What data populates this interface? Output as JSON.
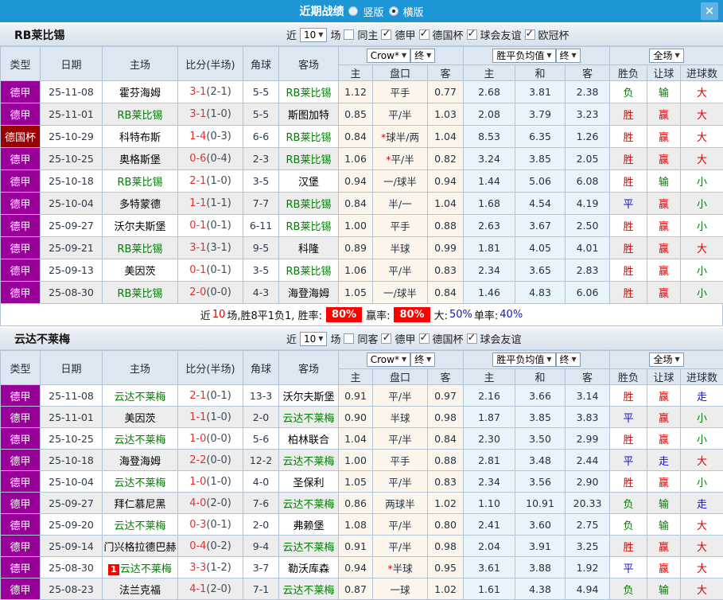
{
  "titlebar": {
    "title": "近期战绩",
    "layout_options": [
      {
        "label": "竖版",
        "selected": false
      },
      {
        "label": "横版",
        "selected": true
      }
    ],
    "close_icon": "✕"
  },
  "table_header": {
    "base_cols": [
      "类型",
      "日期",
      "主场",
      "比分(半场)",
      "角球",
      "客场"
    ],
    "groups": [
      {
        "selects": [
          "Crow*",
          "终"
        ],
        "sub": [
          "主",
          "盘口",
          "客"
        ]
      },
      {
        "selects": [
          "胜平负均值",
          "终"
        ],
        "sub": [
          "主",
          "和",
          "客"
        ]
      },
      {
        "selects": [
          "全场"
        ],
        "sub": [
          "胜负",
          "让球",
          "进球数"
        ]
      }
    ]
  },
  "colors": {
    "topbar_blue": "#1e96d5",
    "league": {
      "德甲": "#99009a",
      "德国杯": "#990000"
    },
    "outcome": {
      "胜": "#dd0000",
      "平": "#1414cc",
      "负": "#008000",
      "赢": "#dd0000",
      "输": "#008000",
      "走": "#1414cc",
      "大": "#dd0000",
      "小": "#008000"
    },
    "score_red": "#e13232",
    "highlight_green": "#008000"
  },
  "sections": [
    {
      "team": "RB莱比锡",
      "filter": {
        "near": "近",
        "count": "10",
        "unit": "场",
        "same_label": "同主",
        "same_checked": false,
        "leagues": [
          "德甲",
          "德国杯",
          "球会友谊",
          "欧冠杯"
        ]
      },
      "rows": [
        {
          "league": "德甲",
          "date": "25-11-08",
          "home": "霍芬海姆",
          "home_hl": false,
          "home_badge": "",
          "score": "3-1",
          "half": "(2-1)",
          "corners": "5-5",
          "away": "RB莱比锡",
          "away_hl": true,
          "odds": [
            "1.12",
            "平手",
            "0.77"
          ],
          "star": false,
          "avg": [
            "2.68",
            "3.81",
            "2.38"
          ],
          "results": [
            "负",
            "输",
            "大"
          ]
        },
        {
          "league": "德甲",
          "date": "25-11-01",
          "home": "RB莱比锡",
          "home_hl": true,
          "home_badge": "",
          "score": "3-1",
          "half": "(1-0)",
          "corners": "5-5",
          "away": "斯图加特",
          "away_hl": false,
          "odds": [
            "0.85",
            "平/半",
            "1.03"
          ],
          "star": false,
          "avg": [
            "2.08",
            "3.79",
            "3.23"
          ],
          "results": [
            "胜",
            "赢",
            "大"
          ]
        },
        {
          "league": "德国杯",
          "date": "25-10-29",
          "home": "科特布斯",
          "home_hl": false,
          "home_badge": "",
          "score": "1-4",
          "half": "(0-3)",
          "corners": "6-6",
          "away": "RB莱比锡",
          "away_hl": true,
          "odds": [
            "0.84",
            "球半/两",
            "1.04"
          ],
          "star": true,
          "avg": [
            "8.53",
            "6.35",
            "1.26"
          ],
          "results": [
            "胜",
            "赢",
            "大"
          ]
        },
        {
          "league": "德甲",
          "date": "25-10-25",
          "home": "奥格斯堡",
          "home_hl": false,
          "home_badge": "",
          "score": "0-6",
          "half": "(0-4)",
          "corners": "2-3",
          "away": "RB莱比锡",
          "away_hl": true,
          "odds": [
            "1.06",
            "平/半",
            "0.82"
          ],
          "star": true,
          "avg": [
            "3.24",
            "3.85",
            "2.05"
          ],
          "results": [
            "胜",
            "赢",
            "大"
          ]
        },
        {
          "league": "德甲",
          "date": "25-10-18",
          "home": "RB莱比锡",
          "home_hl": true,
          "home_badge": "",
          "score": "2-1",
          "half": "(1-0)",
          "corners": "3-5",
          "away": "汉堡",
          "away_hl": false,
          "odds": [
            "0.94",
            "一/球半",
            "0.94"
          ],
          "star": false,
          "avg": [
            "1.44",
            "5.06",
            "6.08"
          ],
          "results": [
            "胜",
            "输",
            "小"
          ]
        },
        {
          "league": "德甲",
          "date": "25-10-04",
          "home": "多特蒙德",
          "home_hl": false,
          "home_badge": "",
          "score": "1-1",
          "half": "(1-1)",
          "corners": "7-7",
          "away": "RB莱比锡",
          "away_hl": true,
          "odds": [
            "0.84",
            "半/一",
            "1.04"
          ],
          "star": false,
          "avg": [
            "1.68",
            "4.54",
            "4.19"
          ],
          "results": [
            "平",
            "赢",
            "小"
          ]
        },
        {
          "league": "德甲",
          "date": "25-09-27",
          "home": "沃尔夫斯堡",
          "home_hl": false,
          "home_badge": "",
          "score": "0-1",
          "half": "(0-1)",
          "corners": "6-11",
          "away": "RB莱比锡",
          "away_hl": true,
          "odds": [
            "1.00",
            "平手",
            "0.88"
          ],
          "star": false,
          "avg": [
            "2.63",
            "3.67",
            "2.50"
          ],
          "results": [
            "胜",
            "赢",
            "小"
          ]
        },
        {
          "league": "德甲",
          "date": "25-09-21",
          "home": "RB莱比锡",
          "home_hl": true,
          "home_badge": "",
          "score": "3-1",
          "half": "(3-1)",
          "corners": "9-5",
          "away": "科隆",
          "away_hl": false,
          "odds": [
            "0.89",
            "半球",
            "0.99"
          ],
          "star": false,
          "avg": [
            "1.81",
            "4.05",
            "4.01"
          ],
          "results": [
            "胜",
            "赢",
            "大"
          ]
        },
        {
          "league": "德甲",
          "date": "25-09-13",
          "home": "美因茨",
          "home_hl": false,
          "home_badge": "",
          "score": "0-1",
          "half": "(0-1)",
          "corners": "3-5",
          "away": "RB莱比锡",
          "away_hl": true,
          "odds": [
            "1.06",
            "平/半",
            "0.83"
          ],
          "star": false,
          "avg": [
            "2.34",
            "3.65",
            "2.83"
          ],
          "results": [
            "胜",
            "赢",
            "小"
          ]
        },
        {
          "league": "德甲",
          "date": "25-08-30",
          "home": "RB莱比锡",
          "home_hl": true,
          "home_badge": "",
          "score": "2-0",
          "half": "(0-0)",
          "corners": "4-3",
          "away": "海登海姆",
          "away_hl": false,
          "odds": [
            "1.05",
            "一/球半",
            "0.84"
          ],
          "star": false,
          "avg": [
            "1.46",
            "4.83",
            "6.06"
          ],
          "results": [
            "胜",
            "赢",
            "小"
          ]
        }
      ],
      "summary": [
        {
          "text": "近"
        },
        {
          "text": "10",
          "style": "red"
        },
        {
          "text": "场,胜8平1负1, 胜率:"
        },
        {
          "text": "80%",
          "style": "badge"
        },
        {
          "text": "赢率:"
        },
        {
          "text": "80%",
          "style": "badge"
        },
        {
          "text": "大:"
        },
        {
          "text": "50%",
          "style": "blue"
        },
        {
          "text": " 单率:"
        },
        {
          "text": "40%",
          "style": "blue"
        }
      ]
    },
    {
      "team": "云达不莱梅",
      "filter": {
        "near": "近",
        "count": "10",
        "unit": "场",
        "same_label": "同客",
        "same_checked": false,
        "leagues": [
          "德甲",
          "德国杯",
          "球会友谊"
        ]
      },
      "rows": [
        {
          "league": "德甲",
          "date": "25-11-08",
          "home": "云达不莱梅",
          "home_hl": true,
          "home_badge": "",
          "score": "2-1",
          "half": "(0-1)",
          "corners": "13-3",
          "away": "沃尔夫斯堡",
          "away_hl": false,
          "odds": [
            "0.91",
            "平/半",
            "0.97"
          ],
          "star": false,
          "avg": [
            "2.16",
            "3.66",
            "3.14"
          ],
          "results": [
            "胜",
            "赢",
            "走"
          ]
        },
        {
          "league": "德甲",
          "date": "25-11-01",
          "home": "美因茨",
          "home_hl": false,
          "home_badge": "",
          "score": "1-1",
          "half": "(1-0)",
          "corners": "2-0",
          "away": "云达不莱梅",
          "away_hl": true,
          "odds": [
            "0.90",
            "半球",
            "0.98"
          ],
          "star": false,
          "avg": [
            "1.87",
            "3.85",
            "3.83"
          ],
          "results": [
            "平",
            "赢",
            "小"
          ]
        },
        {
          "league": "德甲",
          "date": "25-10-25",
          "home": "云达不莱梅",
          "home_hl": true,
          "home_badge": "",
          "score": "1-0",
          "half": "(0-0)",
          "corners": "5-6",
          "away": "柏林联合",
          "away_hl": false,
          "odds": [
            "1.04",
            "平/半",
            "0.84"
          ],
          "star": false,
          "avg": [
            "2.30",
            "3.50",
            "2.99"
          ],
          "results": [
            "胜",
            "赢",
            "小"
          ]
        },
        {
          "league": "德甲",
          "date": "25-10-18",
          "home": "海登海姆",
          "home_hl": false,
          "home_badge": "",
          "score": "2-2",
          "half": "(0-0)",
          "corners": "12-2",
          "away": "云达不莱梅",
          "away_hl": true,
          "odds": [
            "1.00",
            "平手",
            "0.88"
          ],
          "star": false,
          "avg": [
            "2.81",
            "3.48",
            "2.44"
          ],
          "results": [
            "平",
            "走",
            "大"
          ]
        },
        {
          "league": "德甲",
          "date": "25-10-04",
          "home": "云达不莱梅",
          "home_hl": true,
          "home_badge": "",
          "score": "1-0",
          "half": "(1-0)",
          "corners": "4-0",
          "away": "圣保利",
          "away_hl": false,
          "odds": [
            "1.05",
            "平/半",
            "0.83"
          ],
          "star": false,
          "avg": [
            "2.34",
            "3.56",
            "2.90"
          ],
          "results": [
            "胜",
            "赢",
            "小"
          ]
        },
        {
          "league": "德甲",
          "date": "25-09-27",
          "home": "拜仁慕尼黑",
          "home_hl": false,
          "home_badge": "",
          "score": "4-0",
          "half": "(2-0)",
          "corners": "7-6",
          "away": "云达不莱梅",
          "away_hl": true,
          "odds": [
            "0.86",
            "两球半",
            "1.02"
          ],
          "star": false,
          "avg": [
            "1.10",
            "10.91",
            "20.33"
          ],
          "results": [
            "负",
            "输",
            "走"
          ]
        },
        {
          "league": "德甲",
          "date": "25-09-20",
          "home": "云达不莱梅",
          "home_hl": true,
          "home_badge": "",
          "score": "0-3",
          "half": "(0-1)",
          "corners": "2-0",
          "away": "弗赖堡",
          "away_hl": false,
          "odds": [
            "1.08",
            "平/半",
            "0.80"
          ],
          "star": false,
          "avg": [
            "2.41",
            "3.60",
            "2.75"
          ],
          "results": [
            "负",
            "输",
            "大"
          ]
        },
        {
          "league": "德甲",
          "date": "25-09-14",
          "home": "门兴格拉德巴赫",
          "home_hl": false,
          "home_badge": "",
          "score": "0-4",
          "half": "(0-2)",
          "corners": "9-4",
          "away": "云达不莱梅",
          "away_hl": true,
          "odds": [
            "0.91",
            "平/半",
            "0.98"
          ],
          "star": false,
          "avg": [
            "2.04",
            "3.91",
            "3.25"
          ],
          "results": [
            "胜",
            "赢",
            "大"
          ]
        },
        {
          "league": "德甲",
          "date": "25-08-30",
          "home": "云达不莱梅",
          "home_hl": true,
          "home_badge": "1",
          "score": "3-3",
          "half": "(1-2)",
          "corners": "3-7",
          "away": "勒沃库森",
          "away_hl": false,
          "odds": [
            "0.94",
            "半球",
            "0.95"
          ],
          "star": true,
          "avg": [
            "3.61",
            "3.88",
            "1.92"
          ],
          "results": [
            "平",
            "赢",
            "大"
          ]
        },
        {
          "league": "德甲",
          "date": "25-08-23",
          "home": "法兰克福",
          "home_hl": false,
          "home_badge": "",
          "score": "4-1",
          "half": "(2-0)",
          "corners": "7-1",
          "away": "云达不莱梅",
          "away_hl": true,
          "odds": [
            "0.87",
            "一球",
            "1.02"
          ],
          "star": false,
          "avg": [
            "1.61",
            "4.38",
            "4.94"
          ],
          "results": [
            "负",
            "输",
            "大"
          ]
        }
      ],
      "summary": null
    }
  ]
}
